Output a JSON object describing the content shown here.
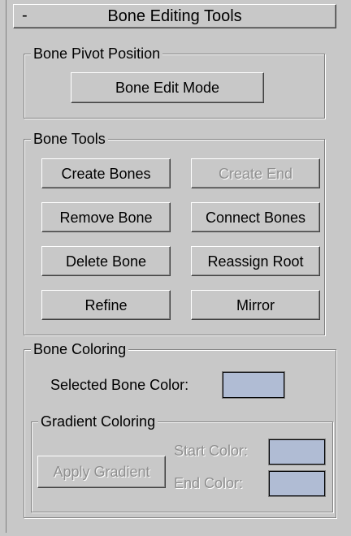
{
  "rollout": {
    "collapse_symbol": "-",
    "title": "Bone Editing Tools"
  },
  "pivot_group": {
    "label": "Bone Pivot Position",
    "edit_mode_label": "Bone Edit Mode"
  },
  "tools_group": {
    "label": "Bone Tools",
    "create_bones": "Create Bones",
    "create_end": "Create End",
    "remove_bone": "Remove Bone",
    "connect_bones": "Connect Bones",
    "delete_bone": "Delete Bone",
    "reassign_root": "Reassign Root",
    "refine": "Refine",
    "mirror": "Mirror"
  },
  "coloring_group": {
    "label": "Bone Coloring",
    "selected_color_label": "Selected Bone Color:",
    "selected_color": "#b0bcd4"
  },
  "gradient_group": {
    "label": "Gradient Coloring",
    "apply_label": "Apply Gradient",
    "start_label": "Start Color:",
    "end_label": "End Color:",
    "start_color": "#b0bcd4",
    "end_color": "#b0bcd4"
  },
  "colors": {
    "panel_bg": "#c8c8c8",
    "disabled_text": "#8f8f8f"
  }
}
